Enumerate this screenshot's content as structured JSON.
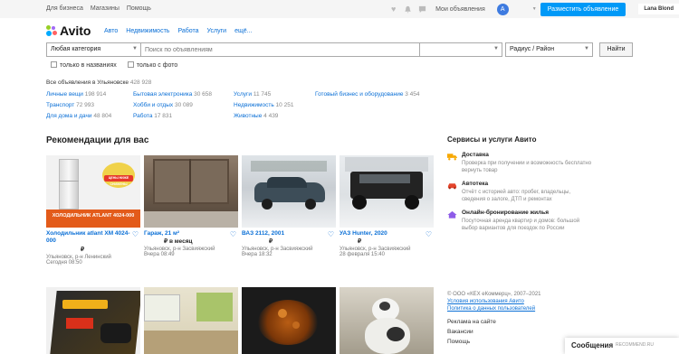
{
  "topbar": {
    "links": [
      "Для бизнеса",
      "Магазины",
      "Помощь"
    ],
    "my_ads": "Мои объявления",
    "avatar_letter": "A",
    "post_button": "Разместить объявление",
    "username": "Lana Blond"
  },
  "logo": {
    "text": "Avito",
    "colors": [
      "#97cf26",
      "#0af",
      "#ff6163",
      "#a169f7"
    ]
  },
  "nav": {
    "items": [
      "Авто",
      "Недвижимость",
      "Работа",
      "Услуги",
      "ещё..."
    ]
  },
  "search": {
    "category": "Любая категория",
    "placeholder": "Поиск по объявлениям",
    "region_value": "",
    "radius": "Радиус / Район",
    "button": "Найти",
    "check_titles": "только в названиях",
    "check_photo": "только с фото"
  },
  "all_ads": {
    "label": "Все объявления в Ульяновске",
    "count": "428 928"
  },
  "categories": [
    {
      "label": "Личные вещи",
      "count": "198 914"
    },
    {
      "label": "Транспорт",
      "count": "72 993"
    },
    {
      "label": "Для дома и дачи",
      "count": "48 804"
    },
    {
      "label": "Бытовая электроника",
      "count": "30 658"
    },
    {
      "label": "Хобби и отдых",
      "count": "30 089"
    },
    {
      "label": "Работа",
      "count": "17 831"
    },
    {
      "label": "Услуги",
      "count": "11 745"
    },
    {
      "label": "Недвижимость",
      "count": "10 251"
    },
    {
      "label": "Животные",
      "count": "4 439"
    },
    {
      "label": "Готовый бизнес и оборудование",
      "count": "3 454"
    }
  ],
  "recommendations": {
    "title": "Рекомендации для вас",
    "cards": [
      {
        "title": "Холодильник atlant XM 4024-000",
        "price": "₽",
        "loc": "Ульяновск, р-н Ленинский",
        "date": "Сегодня 08:50",
        "img_label": "ХОЛОДИЛЬНИК ATLANT 4024-000",
        "badge": "ЦЕНЫ НИЖЕ СНИЖЕНЫ"
      },
      {
        "title": "Гараж, 21 м²",
        "price": "₽ в месяц",
        "loc": "Ульяновск, р-н Засвияжский",
        "date": "Вчера 08:49"
      },
      {
        "title": "ВАЗ 2112, 2001",
        "price": "₽",
        "loc": "Ульяновск, р-н Засвияжский",
        "date": "Вчера 18:32"
      },
      {
        "title": "УАЗ Hunter, 2020",
        "price": "₽",
        "loc": "Ульяновск, р-н Засвияжский",
        "date": "28 февраля 15:40"
      }
    ]
  },
  "services": {
    "title": "Сервисы и услуги Авито",
    "items": [
      {
        "title": "Доставка",
        "desc": "Проверка при получении и возможность бесплатно вернуть товар"
      },
      {
        "title": "Автотека",
        "desc": "Отчёт с историей авто: пробег, владельцы, сведения о залоге, ДТП и ремонтах"
      },
      {
        "title": "Онлайн-бронирование жилья",
        "desc": "Посуточная аренда квартир и домов: большой выбор вариантов для поездок по России"
      }
    ]
  },
  "footer": {
    "copyright": "© ООО «КЕХ еКоммерц», 2007–2021",
    "terms": "Условия использования Авито",
    "privacy": "Политика о данных пользователей",
    "ads": "Реклама на сайте",
    "jobs": "Вакансии",
    "help": "Помощь"
  },
  "messages": {
    "label": "Сообщения",
    "watermark": "RECOMMEND.RU"
  }
}
